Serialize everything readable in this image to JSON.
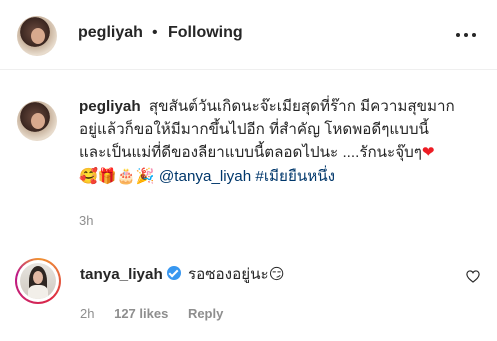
{
  "header": {
    "username": "pegliyah",
    "separator": "•",
    "follow_label": "Following"
  },
  "caption": {
    "username": "pegliyah",
    "line1": "สุขสันต์วันเกิดนะจ๊ะเมียสุดที่ร๊าก มีความสุขมาก",
    "line2": "อยู่แล้วก็ขอให้มีมากขึ้นไปอีก ที่สำคัญ โหดพอดีๆแบบนี้",
    "line3": "และเป็นแม่ที่ดีของลียาแบบนี้ตลอดไปนะ ....รักนะจุ๊บๆ",
    "heart": "❤",
    "emojis": "🥰🎁🎂🎉",
    "mention": "@tanya_liyah",
    "hashtag": "#เมียยืนหนึ่ง",
    "time": "3h"
  },
  "comment": {
    "username": "tanya_liyah",
    "text": "รอซองอยู่นะ",
    "emoji": "😏",
    "time": "2h",
    "likes": "127 likes",
    "reply_label": "Reply"
  },
  "icons": {
    "more": "more-options-icon",
    "like": "heart-outline-icon",
    "verified": "verified-badge-icon"
  },
  "colors": {
    "link": "#00376b",
    "verified": "#3897f0",
    "heart": "#ed1c24",
    "meta": "#8e8e8e"
  }
}
